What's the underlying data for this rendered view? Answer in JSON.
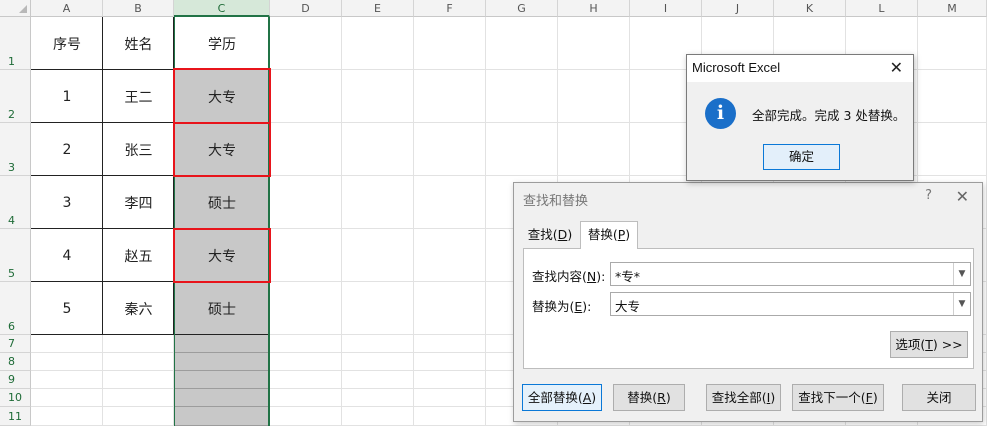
{
  "sheet": {
    "columns": [
      "A",
      "B",
      "C",
      "D",
      "E",
      "F",
      "G",
      "H",
      "I",
      "J",
      "K",
      "L",
      "M"
    ],
    "rows": [
      "1",
      "2",
      "3",
      "4",
      "5",
      "6",
      "7",
      "8",
      "9",
      "10",
      "11"
    ],
    "selected_column": "C",
    "headers": [
      "序号",
      "姓名",
      "学历"
    ],
    "data": [
      [
        "1",
        "王二",
        "大专"
      ],
      [
        "2",
        "张三",
        "大专"
      ],
      [
        "3",
        "李四",
        "硕士"
      ],
      [
        "4",
        "赵五",
        "大专"
      ],
      [
        "5",
        "秦六",
        "硕士"
      ]
    ],
    "highlight_color": "#e8141b",
    "selection_color": "#217346",
    "fill_color": "#c8c8c8"
  },
  "message_box": {
    "title": "Microsoft Excel",
    "icon": "info-icon",
    "message": "全部完成。完成 3 处替换。",
    "ok_label": "确定"
  },
  "find_replace": {
    "title": "查找和替换",
    "help": "?",
    "tabs": [
      {
        "label": "查找(",
        "key": "D",
        "end": ")"
      },
      {
        "label": "替换(",
        "key": "P",
        "end": ")"
      }
    ],
    "find_label": {
      "label": "查找内容(",
      "key": "N",
      "end": "):"
    },
    "find_value": "*专*",
    "replace_label": {
      "label": "替换为(",
      "key": "E",
      "end": "):"
    },
    "replace_value": "大专",
    "options_button": {
      "label": "选项(",
      "key": "T",
      "end": ") >>"
    },
    "buttons": [
      {
        "label": "全部替换(",
        "key": "A",
        "end": ")"
      },
      {
        "label": "替换(",
        "key": "R",
        "end": ")"
      },
      {
        "label": "查找全部(",
        "key": "I",
        "end": ")"
      },
      {
        "label": "查找下一个(",
        "key": "F",
        "end": ")"
      },
      {
        "label": "关闭",
        "key": "",
        "end": ""
      }
    ]
  }
}
